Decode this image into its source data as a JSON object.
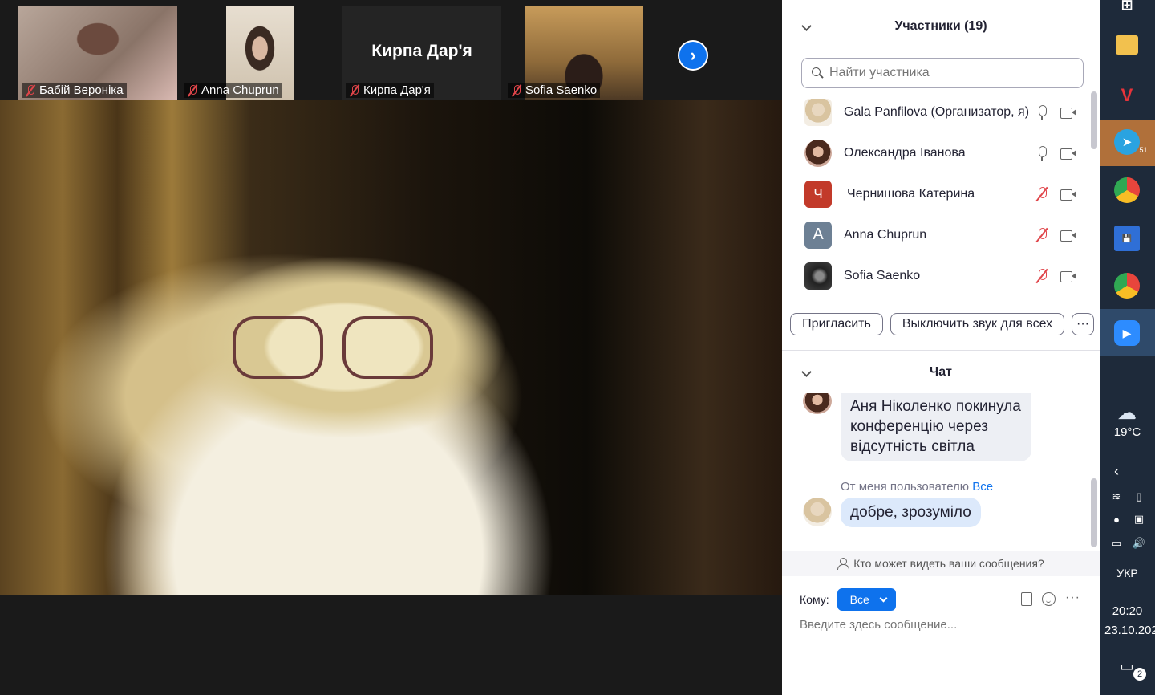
{
  "thumbnails": [
    {
      "name": "Бабій Вероніка",
      "muted": true
    },
    {
      "name": "Anna Chuprun",
      "muted": true
    },
    {
      "name": "Кирпа Дар'я",
      "big_label": "Кирпа Дар'я",
      "muted": true
    },
    {
      "name": "Sofia Saenko",
      "muted": true
    }
  ],
  "next_page_icon": "chevron-right-icon",
  "participants_panel": {
    "title": "Участники (19)",
    "search_placeholder": "Найти участника",
    "participants": [
      {
        "name": "Gala Panfilova (Организатор, я)",
        "avatar": "photo",
        "mic": "on"
      },
      {
        "name": "Олександра Іванова",
        "avatar": "photo",
        "mic": "on"
      },
      {
        "name": "Чернишова Катерина",
        "avatar_letter": "Ч",
        "avatar_color": "#c23a2a",
        "mic": "off"
      },
      {
        "name": "Anna Chuprun",
        "avatar_letter": "A",
        "avatar_color": "#6d8094",
        "mic": "off"
      },
      {
        "name": "Sofia Saenko",
        "avatar": "photo",
        "mic": "off"
      }
    ],
    "invite_label": "Пригласить",
    "mute_all_label": "Выключить звук для всех",
    "more_label": "···"
  },
  "chat_panel": {
    "title": "Чат",
    "messages": [
      {
        "text": "Аня Ніколенко покинула конференцію через відсутність світла",
        "mine": false
      },
      {
        "meta_prefix": "От меня пользователю",
        "meta_to": "Все",
        "text": "добре, зрозуміло",
        "mine": true
      }
    ],
    "who_can_see": "Кто может видеть ваши сообщения?",
    "to_label": "Кому:",
    "to_value": "Все",
    "input_placeholder": "Введите здесь сообщение..."
  },
  "taskbar": {
    "telegram_badge": "51",
    "weather": "19°C",
    "language": "УКР",
    "time": "20:20",
    "date": "23.10.202",
    "notifications": "2"
  },
  "colors": {
    "accent": "#0e72ed",
    "muted_red": "#e0454a",
    "taskbar_bg": "#1e2a3a"
  }
}
